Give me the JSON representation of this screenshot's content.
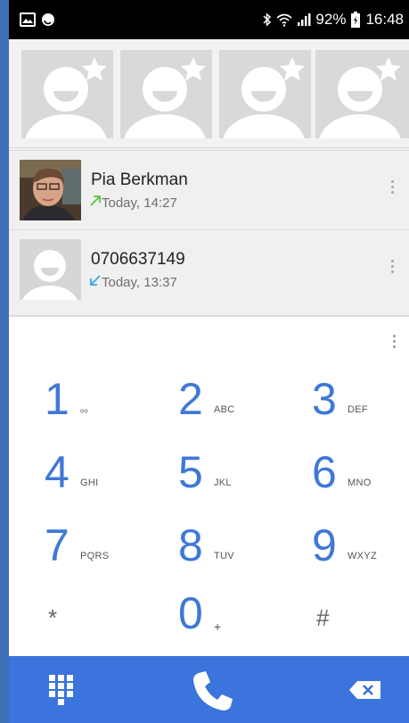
{
  "status_bar": {
    "battery_percent": "92%",
    "time": "16:48",
    "icons": [
      "gallery-icon",
      "sync-icon",
      "bluetooth-icon",
      "wifi-icon",
      "signal-icon",
      "battery-icon"
    ]
  },
  "favorites": {
    "tiles": [
      {
        "icon": "contact-placeholder-icon",
        "badge": "star-icon"
      },
      {
        "icon": "contact-placeholder-icon",
        "badge": "star-icon"
      },
      {
        "icon": "contact-placeholder-icon",
        "badge": "star-icon"
      },
      {
        "icon": "contact-placeholder-icon",
        "badge": "star-icon"
      }
    ]
  },
  "recents": [
    {
      "name": "Pia Berkman",
      "time": "Today, 14:27",
      "direction": "outgoing",
      "arrow_color": "#5cc23a",
      "photo": "photo"
    },
    {
      "name": "0706637149",
      "time": "Today, 13:37",
      "direction": "incoming",
      "arrow_color": "#3aa3e3",
      "photo": "placeholder"
    }
  ],
  "keypad": {
    "keys": [
      {
        "digit": "1",
        "letters": "ₒₒ"
      },
      {
        "digit": "2",
        "letters": "ABC"
      },
      {
        "digit": "3",
        "letters": "DEF"
      },
      {
        "digit": "4",
        "letters": "GHI"
      },
      {
        "digit": "5",
        "letters": "JKL"
      },
      {
        "digit": "6",
        "letters": "MNO"
      },
      {
        "digit": "7",
        "letters": "PQRS"
      },
      {
        "digit": "8",
        "letters": "TUV"
      },
      {
        "digit": "9",
        "letters": "WXYZ"
      },
      {
        "digit": "*",
        "letters": ""
      },
      {
        "digit": "0",
        "letters": "+"
      },
      {
        "digit": "#",
        "letters": ""
      }
    ],
    "digit_color": "#3f78d6"
  },
  "bottom_bar": {
    "color": "#3a74dc",
    "buttons": [
      "dialpad-icon",
      "call-icon",
      "backspace-icon"
    ]
  }
}
